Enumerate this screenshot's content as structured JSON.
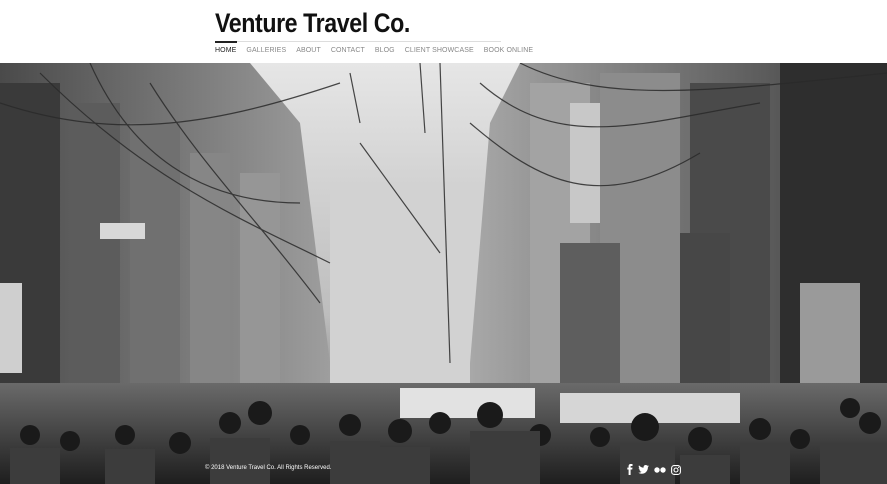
{
  "site": {
    "title": "Venture Travel Co."
  },
  "nav": {
    "items": [
      {
        "label": "HOME",
        "active": true
      },
      {
        "label": "GALLERIES",
        "active": false
      },
      {
        "label": "ABOUT",
        "active": false
      },
      {
        "label": "CONTACT",
        "active": false
      },
      {
        "label": "BLOG",
        "active": false
      },
      {
        "label": "CLIENT SHOWCASE",
        "active": false
      },
      {
        "label": "BOOK ONLINE",
        "active": false
      }
    ]
  },
  "hero": {
    "image_icon": "street-scene-photo"
  },
  "footer": {
    "copyright": "© 2018 Venture Travel Co. All Rights Reserved.",
    "social": [
      "facebook-icon",
      "twitter-icon",
      "flickr-icon",
      "instagram-icon"
    ]
  },
  "colors": {
    "title": "#111111",
    "nav_active": "#222222",
    "nav_inactive": "#888888",
    "footer_text": "#ffffff"
  }
}
